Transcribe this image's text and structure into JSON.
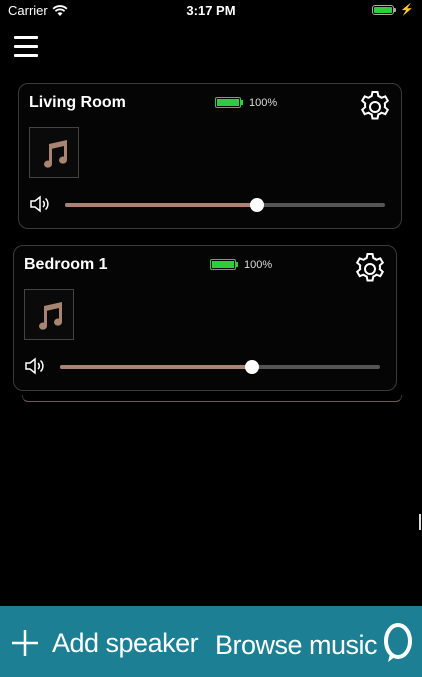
{
  "status_bar": {
    "carrier": "Carrier",
    "time": "3:17 PM"
  },
  "speakers": [
    {
      "name": "Living Room",
      "battery_text": "100%",
      "battery_level": 1.0,
      "volume": 0.6
    },
    {
      "name": "Bedroom 1",
      "battery_text": "100%",
      "battery_level": 1.0,
      "volume": 0.6
    }
  ],
  "bottom_bar": {
    "add_label": "Add speaker",
    "browse_label": "Browse music"
  },
  "colors": {
    "accent_bar": "#1d7f94",
    "slider_fill": "#a88572",
    "battery": "#2ecc40",
    "music_note": "#a88572"
  },
  "icons": [
    "wifi-icon",
    "battery-icon",
    "charging-icon",
    "menu-icon",
    "gear-icon",
    "music-note-icon",
    "speaker-volume-icon",
    "plus-icon",
    "alexa-icon"
  ]
}
